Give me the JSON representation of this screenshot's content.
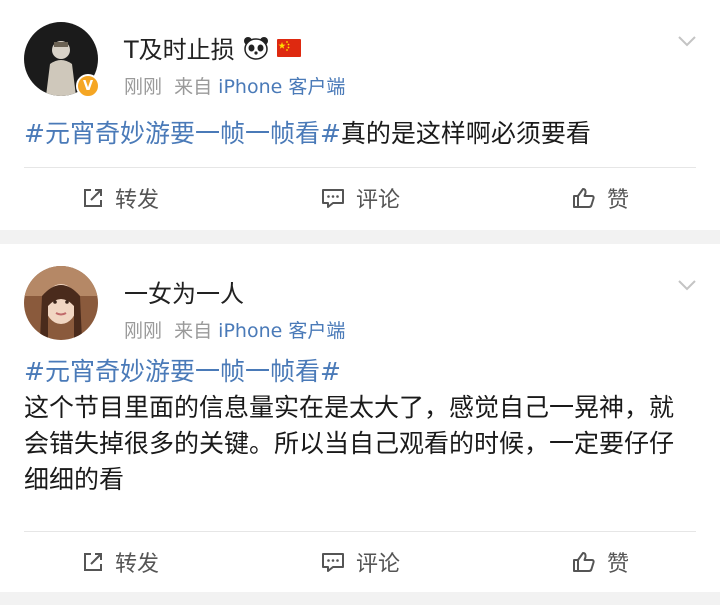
{
  "posts": [
    {
      "user": {
        "name": "T及时止损",
        "emojis": [
          "panda-icon",
          "china-flag-icon"
        ],
        "verified": true
      },
      "meta": {
        "time": "刚刚",
        "from_label": "来自",
        "source": "iPhone 客户端"
      },
      "content": {
        "tag": "#元宵奇妙游要一帧一帧看#",
        "text": "真的是这样啊必须要看"
      },
      "actions": {
        "repost": "转发",
        "comment": "评论",
        "like": "赞"
      }
    },
    {
      "user": {
        "name": "一女为一人",
        "verified": false
      },
      "meta": {
        "time": "刚刚",
        "from_label": "来自",
        "source": "iPhone 客户端"
      },
      "content": {
        "tag": "#元宵奇妙游要一帧一帧看#",
        "text": "这个节目里面的信息量实在是太大了，感觉自己一晃神，就会错失掉很多的关键。所以当自己观看的时候，一定要仔仔细细的看"
      },
      "actions": {
        "repost": "转发",
        "comment": "评论",
        "like": "赞"
      }
    }
  ],
  "colors": {
    "link": "#4a7ab8",
    "meta": "#9a9a9a",
    "badge": "#f5a623",
    "separator": "#f2f2f2"
  }
}
